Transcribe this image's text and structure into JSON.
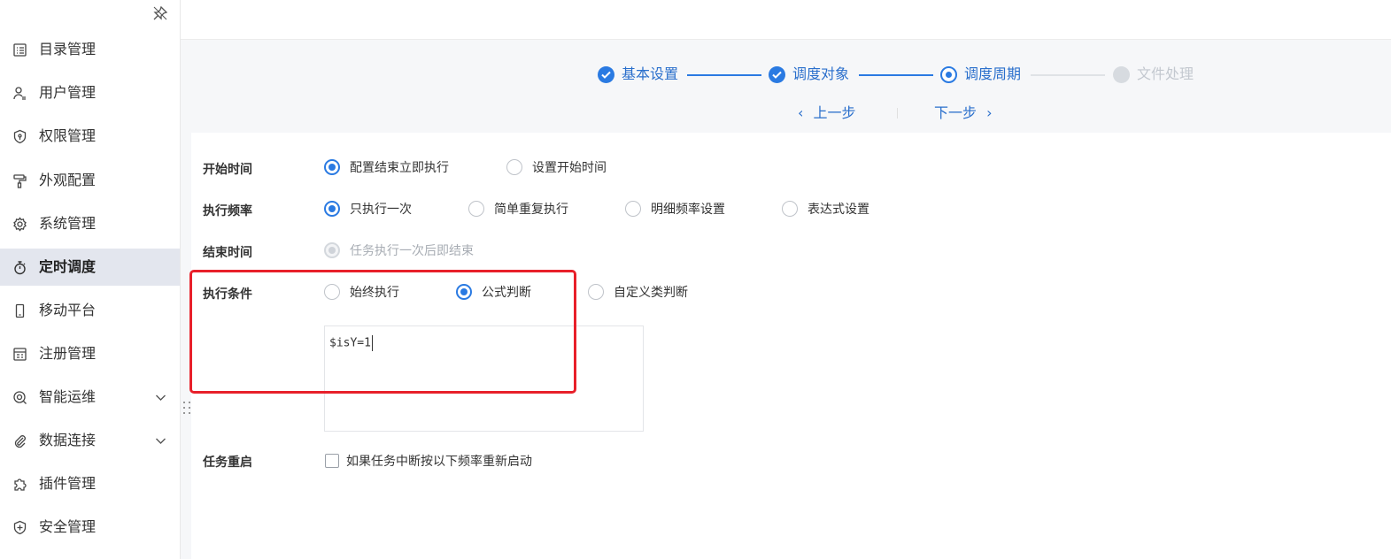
{
  "sidebar": {
    "items": [
      {
        "label": "目录管理",
        "icon": "list-icon"
      },
      {
        "label": "用户管理",
        "icon": "user-icon"
      },
      {
        "label": "权限管理",
        "icon": "shield-icon"
      },
      {
        "label": "外观配置",
        "icon": "paint-roller-icon"
      },
      {
        "label": "系统管理",
        "icon": "gear-icon"
      },
      {
        "label": "定时调度",
        "icon": "stopwatch-icon",
        "active": true
      },
      {
        "label": "移动平台",
        "icon": "mobile-icon"
      },
      {
        "label": "注册管理",
        "icon": "register-icon"
      },
      {
        "label": "智能运维",
        "icon": "ops-icon",
        "expandable": true
      },
      {
        "label": "数据连接",
        "icon": "paperclip-icon",
        "expandable": true
      },
      {
        "label": "插件管理",
        "icon": "puzzle-icon"
      },
      {
        "label": "安全管理",
        "icon": "security-shield-icon"
      }
    ]
  },
  "steps": [
    {
      "label": "基本设置",
      "state": "done"
    },
    {
      "label": "调度对象",
      "state": "done"
    },
    {
      "label": "调度周期",
      "state": "current"
    },
    {
      "label": "文件处理",
      "state": "pending"
    }
  ],
  "nav": {
    "prev": "上一步",
    "next": "下一步"
  },
  "form": {
    "start_time": {
      "label": "开始时间",
      "options": [
        "配置结束立即执行",
        "设置开始时间"
      ],
      "selected": 0
    },
    "frequency": {
      "label": "执行频率",
      "options": [
        "只执行一次",
        "简单重复执行",
        "明细频率设置",
        "表达式设置"
      ],
      "selected": 0
    },
    "end_time": {
      "label": "结束时间",
      "options": [
        "任务执行一次后即结束"
      ],
      "disabled": true
    },
    "condition": {
      "label": "执行条件",
      "options": [
        "始终执行",
        "公式判断",
        "自定义类判断"
      ],
      "selected": 1
    },
    "formula": "$isY=1",
    "restart": {
      "label": "任务重启",
      "checkbox_label": "如果任务中断按以下频率重新启动",
      "checked": false
    }
  },
  "colors": {
    "accent": "#2a7ae2",
    "highlight": "#e8202a",
    "active_bg": "#e3e6ee"
  }
}
